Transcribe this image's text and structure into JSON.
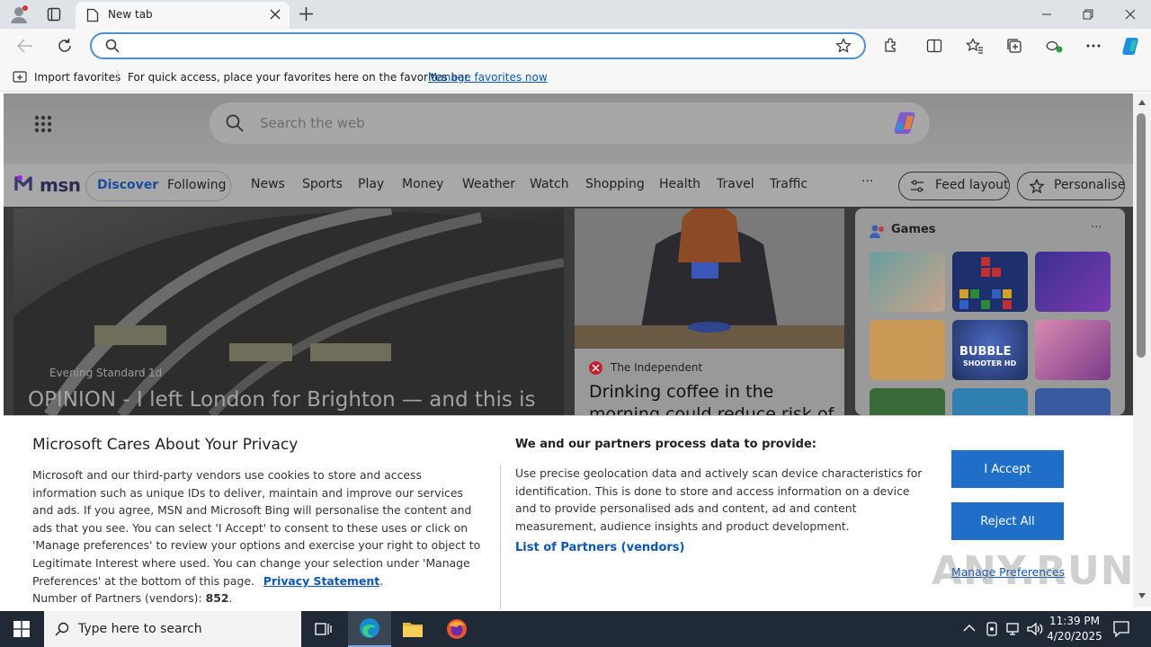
{
  "browser": {
    "tab_title": "New tab",
    "address_value": "",
    "favbar": {
      "import_label": "Import favorites",
      "hint": "For quick access, place your favorites here on the favorites bar.",
      "manage_link": "Manage favorites now"
    }
  },
  "msn": {
    "logo_text": "msn",
    "search_placeholder": "Search the web",
    "nav": {
      "discover": "Discover",
      "following": "Following",
      "links": [
        "News",
        "Sports",
        "Play",
        "Money",
        "Weather",
        "Watch",
        "Shopping",
        "Health",
        "Travel",
        "Traffic"
      ],
      "more": "···",
      "feed_layout": "Feed layout",
      "personalise": "Personalise"
    },
    "hero": {
      "source": "Evening Standard",
      "age": "1d",
      "headline": "OPINION - I left London for Brighton — and this is"
    },
    "card2": {
      "source": "The Independent",
      "headline_line1": "Drinking coffee in the",
      "headline_line2": "morning could reduce risk of"
    },
    "games": {
      "title": "Games",
      "more": "···",
      "bubble_text": "BUBBLE",
      "bubble_sub": "SHOOTER HD"
    }
  },
  "consent": {
    "title": "Microsoft Cares About Your Privacy",
    "body": "Microsoft and our third-party vendors use cookies to store and access information such as unique IDs to deliver, maintain and improve our services and ads. If you agree, MSN and Microsoft Bing will personalise the content and ads that you see. You can select 'I Accept' to consent to these uses or click on 'Manage preferences' to review your options and exercise your right to object to Legitimate Interest where used.  You can change your selection under 'Manage Preferences' at the bottom of this page.",
    "privacy_link": "Privacy Statement",
    "partners_count_label": "Number of Partners (vendors):",
    "partners_count": "852",
    "partners_head": "We and our partners process data to provide:",
    "partners_body": "Use precise geolocation data and actively scan device characteristics for identification. This is done to store and access information on a device and to provide personalised ads and content, ad and content measurement, audience insights and product development.",
    "partners_link": "List of Partners (vendors)",
    "accept": "I Accept",
    "reject": "Reject All",
    "manage": "Manage Preferences"
  },
  "taskbar": {
    "search_placeholder": "Type here to search",
    "time": "11:39 PM",
    "date": "4/20/2025"
  },
  "watermark": "ANY.RUN",
  "colors": {
    "accent": "#1f6fc9",
    "link": "#0b57b6",
    "taskbar": "#1f2a36"
  }
}
